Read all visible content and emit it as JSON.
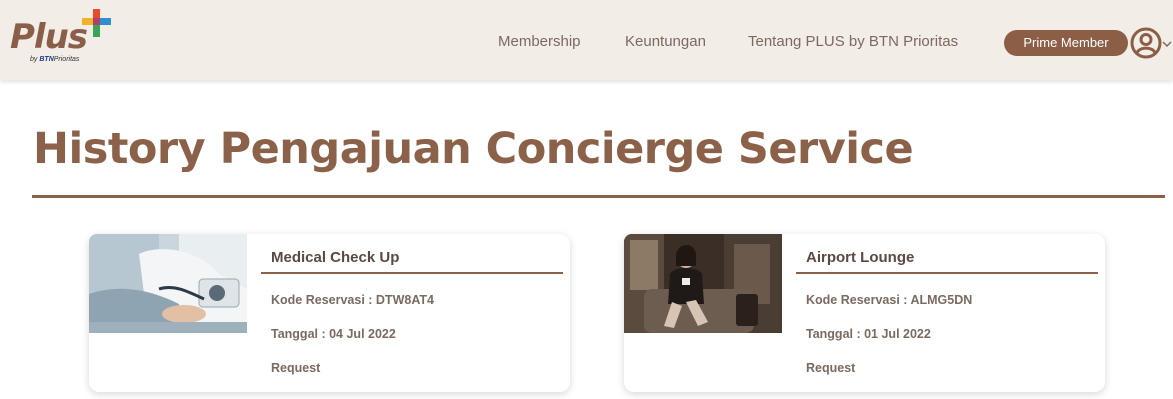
{
  "brand": {
    "logo_text": "Plus",
    "logo_sub_prefix": "by",
    "logo_sub_bank": "BTN",
    "logo_sub_suffix": "Prioritas"
  },
  "nav": {
    "links": [
      "Membership",
      "Keuntungan",
      "Tentang PLUS by BTN Prioritas"
    ],
    "prime_button": "Prime Member",
    "icons": [
      "user-circle-icon",
      "chevron-down-icon"
    ]
  },
  "page": {
    "title": "History Pengajuan Concierge Service"
  },
  "colors": {
    "accent": "#8b6149",
    "navbar_bg": "#f3ede8",
    "button_bg": "#8b5e45"
  },
  "cards": [
    {
      "title": "Medical Check Up",
      "kode": "Kode Reservasi : DTW8AT4",
      "tanggal": "Tanggal : 04 Jul 2022",
      "status": "Request"
    },
    {
      "title": "Airport Lounge",
      "kode": "Kode Reservasi : ALMG5DN",
      "tanggal": "Tanggal : 01 Jul 2022",
      "status": "Request"
    }
  ]
}
